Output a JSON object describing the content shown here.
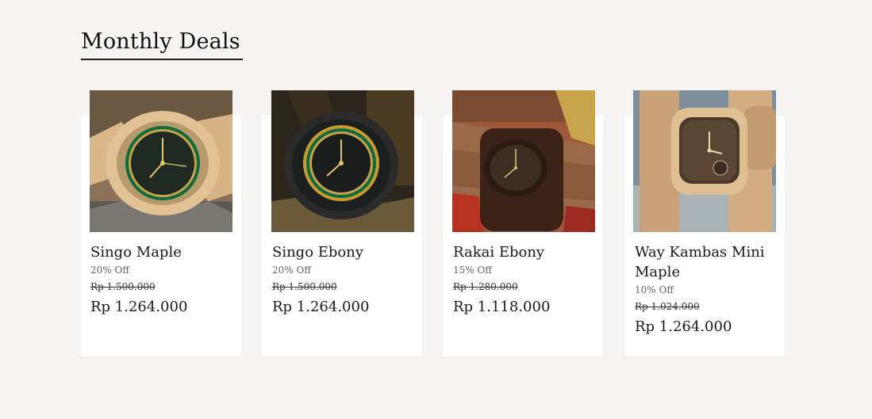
{
  "section": {
    "title": "Monthly Deals"
  },
  "products": [
    {
      "name": "Singo Maple",
      "discount": "20% Off",
      "old_price": "Rp 1.500.000",
      "price": "Rp 1.264.000"
    },
    {
      "name": "Singo Ebony",
      "discount": "20% Off",
      "old_price": "Rp 1.500.000",
      "price": "Rp 1.264.000"
    },
    {
      "name": "Rakai Ebony",
      "discount": "15% Off",
      "old_price": "Rp 1.280.000",
      "price": "Rp 1.118.000"
    },
    {
      "name": "Way Kambas Mini Maple",
      "discount": "10% Off",
      "old_price": "Rp 1.024.000",
      "price": "Rp 1.264.000"
    }
  ]
}
